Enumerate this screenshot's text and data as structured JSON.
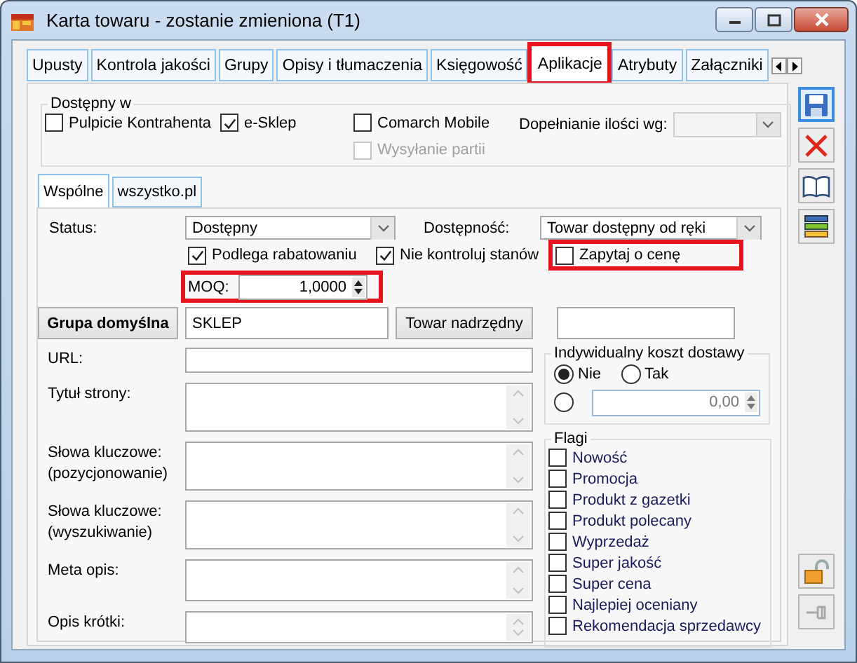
{
  "window": {
    "title": "Karta towaru - zostanie zmieniona (T1)"
  },
  "tabs": [
    {
      "label": "Upusty",
      "selected": false,
      "highlighted": false
    },
    {
      "label": "Kontrola jakości",
      "selected": false,
      "highlighted": false
    },
    {
      "label": "Grupy",
      "selected": false,
      "highlighted": false
    },
    {
      "label": "Opisy i tłumaczenia",
      "selected": false,
      "highlighted": false
    },
    {
      "label": "Księgowość",
      "selected": false,
      "highlighted": false
    },
    {
      "label": "Aplikacje",
      "selected": true,
      "highlighted": true
    },
    {
      "label": "Atrybuty",
      "selected": false,
      "highlighted": false
    },
    {
      "label": "Załączniki",
      "selected": false,
      "highlighted": false
    }
  ],
  "available_in": {
    "title": "Dostępny w",
    "options": [
      {
        "label": "Pulpicie Kontrahenta",
        "checked": false,
        "disabled": false
      },
      {
        "label": "e-Sklep",
        "checked": true,
        "disabled": false
      },
      {
        "label": "Comarch Mobile",
        "checked": false,
        "disabled": false
      },
      {
        "label": "Wysyłanie partii",
        "checked": false,
        "disabled": true
      }
    ],
    "fill_by": {
      "label": "Dopełnianie ilości wg:",
      "disabled": true
    }
  },
  "subtabs": [
    {
      "label": "Wspólne",
      "selected": true
    },
    {
      "label": "wszystko.pl",
      "selected": false
    }
  ],
  "status": {
    "label": "Status:",
    "value": "Dostępny"
  },
  "availability": {
    "label": "Dostępność:",
    "value": "Towar dostępny od ręki"
  },
  "checks": [
    {
      "label": "Podlega rabatowaniu",
      "checked": true,
      "highlighted": false
    },
    {
      "label": "Nie kontroluj stanów",
      "checked": true,
      "highlighted": false
    },
    {
      "label": "Zapytaj o cenę",
      "checked": false,
      "highlighted": true
    }
  ],
  "moq": {
    "label": "MOQ:",
    "value": "1,0000",
    "highlighted": true
  },
  "default_group": {
    "button": "Grupa domyślna",
    "value": "SKLEP"
  },
  "parent_item": {
    "button": "Towar nadrzędny"
  },
  "seo_fields": [
    {
      "label": "URL:",
      "kind": "line"
    },
    {
      "label": "Tytuł strony:",
      "kind": "area"
    },
    {
      "label": "Słowa kluczowe:\n(pozycjonowanie)",
      "kind": "area"
    },
    {
      "label": "Słowa kluczowe:\n(wyszukiwanie)",
      "kind": "area"
    },
    {
      "label": "Meta opis:",
      "kind": "area"
    },
    {
      "label": "Opis krótki:",
      "kind": "area"
    }
  ],
  "delivery_cost": {
    "title": "Indywidualny koszt dostawy",
    "options": [
      {
        "label": "Nie",
        "selected": true
      },
      {
        "label": "Tak",
        "selected": false
      }
    ],
    "custom": {
      "selected": false,
      "value": "0,00"
    }
  },
  "flags": {
    "title": "Flagi",
    "items": [
      {
        "label": "Nowość",
        "checked": false
      },
      {
        "label": "Promocja",
        "checked": false
      },
      {
        "label": "Produkt z gazetki",
        "checked": false
      },
      {
        "label": "Produkt polecany",
        "checked": false
      },
      {
        "label": "Wyprzedaż",
        "checked": false
      },
      {
        "label": "Super jakość",
        "checked": false
      },
      {
        "label": "Super cena",
        "checked": false
      },
      {
        "label": "Najlepiej oceniany",
        "checked": false
      },
      {
        "label": "Rekomendacja sprzedawcy",
        "checked": false
      }
    ]
  }
}
